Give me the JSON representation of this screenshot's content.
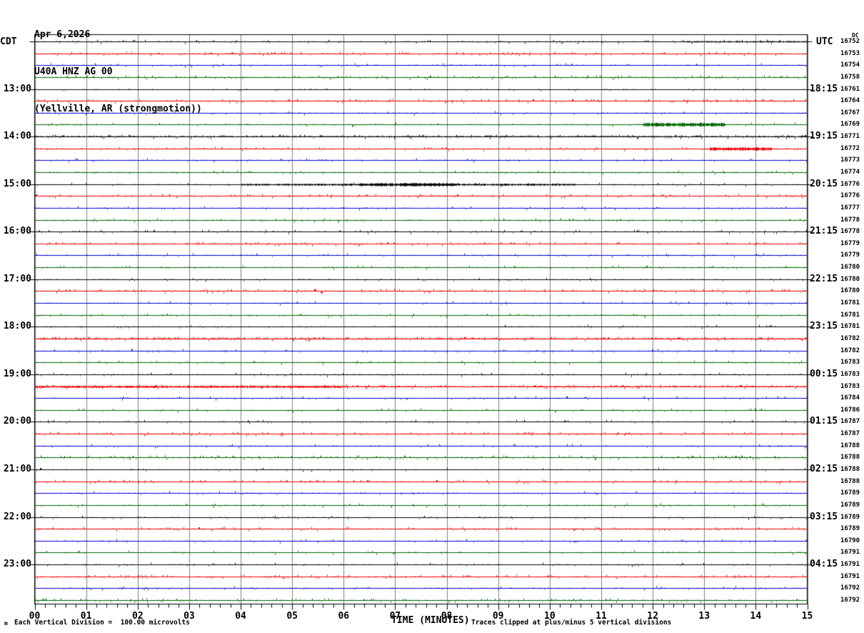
{
  "header": {
    "date_line": "Apr 6,2026",
    "station_line": "U40A HNZ AG 00",
    "location_line": "(Yellville, AR (strongmotion))"
  },
  "footer": {
    "scale_note": "Each Vertical Division =  100.00 microvolts",
    "time_axis_label": "TIME (MINUTES)",
    "clip_note": "Traces clipped at plus/minus 5 vertical divisions",
    "watermark": "m"
  },
  "chart_data": {
    "type": "helicorder",
    "title": "Apr 6,2026",
    "station": "U40A HNZ AG 00",
    "location": "(Yellville, AR (strongmotion))",
    "left_axis_label": "CDT",
    "right_axis_label": "UTC",
    "dc_header": "DC",
    "xlabel": "TIME (MINUTES)",
    "x_range_minutes": [
      0,
      15
    ],
    "x_ticks": [
      "00",
      "01",
      "02",
      "03",
      "04",
      "05",
      "06",
      "07",
      "08",
      "09",
      "10",
      "11",
      "12",
      "13",
      "14",
      "15"
    ],
    "minutes_per_row": 15,
    "rows_total": 48,
    "grid": true,
    "colors": {
      "black": "#000000",
      "red": "#f00000",
      "blue": "#0000d0",
      "green": "#006400",
      "gridline": "#808080",
      "frame": "#000000"
    },
    "rows": [
      {
        "cdt": null,
        "utc": null,
        "dc": "16752",
        "color": "black",
        "noise": 1.5,
        "events": [
          {
            "start": 12.6,
            "end": 15.0,
            "amp": 1.0
          }
        ]
      },
      {
        "cdt": null,
        "utc": null,
        "dc": "16753",
        "color": "red",
        "noise": 2.0,
        "events": []
      },
      {
        "cdt": null,
        "utc": null,
        "dc": "16754",
        "color": "blue",
        "noise": 1.0,
        "events": []
      },
      {
        "cdt": null,
        "utc": null,
        "dc": "16758",
        "color": "green",
        "noise": 2.0,
        "events": []
      },
      {
        "cdt": "13:00",
        "utc": "18:15",
        "dc": "16761",
        "color": "black",
        "noise": 0.7,
        "events": []
      },
      {
        "cdt": null,
        "utc": null,
        "dc": "16764",
        "color": "red",
        "noise": 2.0,
        "events": []
      },
      {
        "cdt": null,
        "utc": null,
        "dc": "16767",
        "color": "blue",
        "noise": 1.0,
        "events": []
      },
      {
        "cdt": null,
        "utc": null,
        "dc": "16769",
        "color": "green",
        "noise": 1.0,
        "events": [
          {
            "start": 11.8,
            "end": 13.4,
            "amp": 3.0
          }
        ]
      },
      {
        "cdt": "14:00",
        "utc": "19:15",
        "dc": "16771",
        "color": "black",
        "noise": 2.5,
        "events": []
      },
      {
        "cdt": null,
        "utc": null,
        "dc": "16772",
        "color": "red",
        "noise": 1.5,
        "events": [
          {
            "start": 13.1,
            "end": 14.3,
            "amp": 2.5
          }
        ]
      },
      {
        "cdt": null,
        "utc": null,
        "dc": "16773",
        "color": "blue",
        "noise": 1.0,
        "events": []
      },
      {
        "cdt": null,
        "utc": null,
        "dc": "16774",
        "color": "green",
        "noise": 1.2,
        "events": []
      },
      {
        "cdt": "15:00",
        "utc": "20:15",
        "dc": "16776",
        "color": "black",
        "noise": 1.0,
        "events": [
          {
            "start": 4.0,
            "end": 10.5,
            "amp": 1.4
          },
          {
            "start": 6.3,
            "end": 8.2,
            "amp": 2.4
          }
        ]
      },
      {
        "cdt": null,
        "utc": null,
        "dc": "16776",
        "color": "red",
        "noise": 2.0,
        "events": []
      },
      {
        "cdt": null,
        "utc": null,
        "dc": "16777",
        "color": "blue",
        "noise": 1.0,
        "events": []
      },
      {
        "cdt": null,
        "utc": null,
        "dc": "16778",
        "color": "green",
        "noise": 1.5,
        "events": []
      },
      {
        "cdt": "16:00",
        "utc": "21:15",
        "dc": "16778",
        "color": "black",
        "noise": 1.8,
        "events": []
      },
      {
        "cdt": null,
        "utc": null,
        "dc": "16779",
        "color": "red",
        "noise": 2.0,
        "events": []
      },
      {
        "cdt": null,
        "utc": null,
        "dc": "16779",
        "color": "blue",
        "noise": 1.0,
        "events": []
      },
      {
        "cdt": null,
        "utc": null,
        "dc": "16780",
        "color": "green",
        "noise": 1.2,
        "events": []
      },
      {
        "cdt": "17:00",
        "utc": "22:15",
        "dc": "16780",
        "color": "black",
        "noise": 1.0,
        "events": []
      },
      {
        "cdt": null,
        "utc": null,
        "dc": "16780",
        "color": "red",
        "noise": 2.2,
        "events": []
      },
      {
        "cdt": null,
        "utc": null,
        "dc": "16781",
        "color": "blue",
        "noise": 1.0,
        "events": []
      },
      {
        "cdt": null,
        "utc": null,
        "dc": "16781",
        "color": "green",
        "noise": 1.2,
        "events": []
      },
      {
        "cdt": "18:00",
        "utc": "23:15",
        "dc": "16781",
        "color": "black",
        "noise": 1.0,
        "events": []
      },
      {
        "cdt": null,
        "utc": null,
        "dc": "16782",
        "color": "red",
        "noise": 3.0,
        "events": []
      },
      {
        "cdt": null,
        "utc": null,
        "dc": "16782",
        "color": "blue",
        "noise": 1.0,
        "events": []
      },
      {
        "cdt": null,
        "utc": null,
        "dc": "16783",
        "color": "green",
        "noise": 1.2,
        "events": []
      },
      {
        "cdt": "19:00",
        "utc": "00:15",
        "dc": "16783",
        "color": "black",
        "noise": 1.2,
        "events": []
      },
      {
        "cdt": null,
        "utc": null,
        "dc": "16783",
        "color": "red",
        "noise": 2.5,
        "events": [
          {
            "start": 0.0,
            "end": 6.0,
            "amp": 1.5
          }
        ]
      },
      {
        "cdt": null,
        "utc": null,
        "dc": "16784",
        "color": "blue",
        "noise": 1.0,
        "events": []
      },
      {
        "cdt": null,
        "utc": null,
        "dc": "16786",
        "color": "green",
        "noise": 1.2,
        "events": []
      },
      {
        "cdt": "20:00",
        "utc": "01:15",
        "dc": "16787",
        "color": "black",
        "noise": 1.0,
        "events": []
      },
      {
        "cdt": null,
        "utc": null,
        "dc": "16787",
        "color": "red",
        "noise": 2.0,
        "events": []
      },
      {
        "cdt": null,
        "utc": null,
        "dc": "16788",
        "color": "blue",
        "noise": 1.0,
        "events": []
      },
      {
        "cdt": null,
        "utc": null,
        "dc": "16788",
        "color": "green",
        "noise": 2.2,
        "events": []
      },
      {
        "cdt": "21:00",
        "utc": "02:15",
        "dc": "16788",
        "color": "black",
        "noise": 0.8,
        "events": []
      },
      {
        "cdt": null,
        "utc": null,
        "dc": "16788",
        "color": "red",
        "noise": 2.0,
        "events": []
      },
      {
        "cdt": null,
        "utc": null,
        "dc": "16789",
        "color": "blue",
        "noise": 1.0,
        "events": []
      },
      {
        "cdt": null,
        "utc": null,
        "dc": "16789",
        "color": "green",
        "noise": 1.2,
        "events": []
      },
      {
        "cdt": "22:00",
        "utc": "03:15",
        "dc": "16789",
        "color": "black",
        "noise": 1.0,
        "events": []
      },
      {
        "cdt": null,
        "utc": null,
        "dc": "16789",
        "color": "red",
        "noise": 2.0,
        "events": []
      },
      {
        "cdt": null,
        "utc": null,
        "dc": "16790",
        "color": "blue",
        "noise": 1.0,
        "events": []
      },
      {
        "cdt": null,
        "utc": null,
        "dc": "16791",
        "color": "green",
        "noise": 1.2,
        "events": []
      },
      {
        "cdt": "23:00",
        "utc": "04:15",
        "dc": "16791",
        "color": "black",
        "noise": 1.0,
        "events": []
      },
      {
        "cdt": null,
        "utc": null,
        "dc": "16791",
        "color": "red",
        "noise": 2.0,
        "events": []
      },
      {
        "cdt": null,
        "utc": null,
        "dc": "16792",
        "color": "blue",
        "noise": 1.0,
        "events": []
      },
      {
        "cdt": null,
        "utc": null,
        "dc": "16792",
        "color": "green",
        "noise": 2.0,
        "events": []
      }
    ]
  }
}
